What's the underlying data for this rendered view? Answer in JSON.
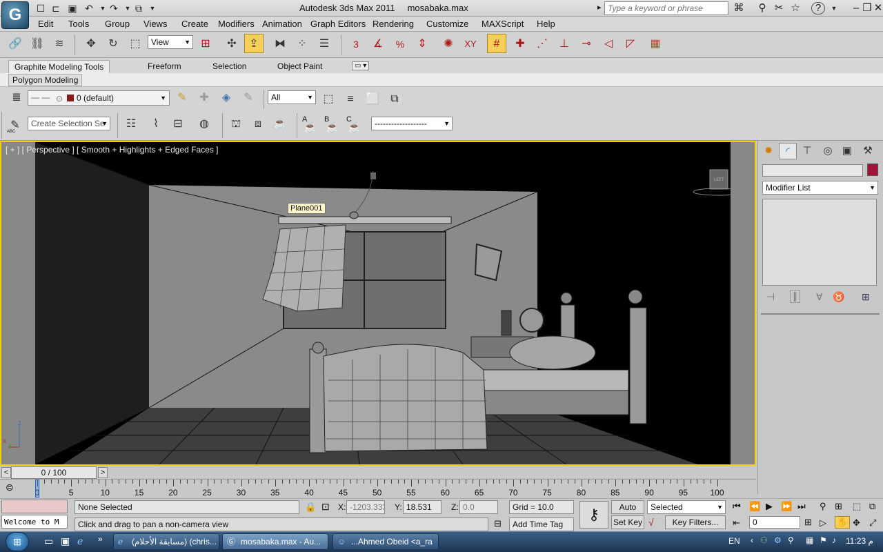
{
  "window": {
    "app_title": "Autodesk 3ds Max  2011",
    "file_name": "mosabaka.max",
    "search_placeholder": "Type a keyword or phrase",
    "help_label": "?"
  },
  "menu": [
    "Edit",
    "Tools",
    "Group",
    "Views",
    "Create",
    "Modifiers",
    "Animation",
    "Graph Editors",
    "Rendering",
    "Customize",
    "MAXScript",
    "Help"
  ],
  "main_toolbar": {
    "reference_coord": "View",
    "snap_3": "3",
    "percent_snap": "%",
    "xy_label": "XY"
  },
  "ribbon": {
    "tabs": [
      "Graphite Modeling Tools",
      "Freeform",
      "Selection",
      "Object Paint"
    ],
    "active_panel": "Polygon Modeling",
    "layer_name": "0 (default)",
    "filter_all": "All",
    "named_selection": "Create Selection Se",
    "dash_dropdown": "-------------------",
    "abc_label": "ABC",
    "a_label": "A",
    "b_label": "B",
    "c_label": "C"
  },
  "viewport": {
    "label": "[ + ] [ Perspective ] [ Smooth + Highlights + Edged Faces ]",
    "tooltip": "Plane001",
    "viewcube_label": "LEFT",
    "axis_z": "z",
    "axis_x": "x",
    "axis_y": "y"
  },
  "command_panel": {
    "object_name": "",
    "modifier_list": "Modifier List"
  },
  "timeline": {
    "slider": "0 / 100",
    "prev": "<",
    "next": ">",
    "ticks": [
      "0",
      "5",
      "10",
      "15",
      "20",
      "25",
      "30",
      "35",
      "40",
      "45",
      "50",
      "55",
      "60",
      "65",
      "70",
      "75",
      "80",
      "85",
      "90",
      "95",
      "100"
    ]
  },
  "status": {
    "listener": "Welcome to M",
    "selection": "None Selected",
    "prompt": "Click and drag to pan a non-camera view",
    "x_label": "X:",
    "x_value": "-1203.333",
    "y_label": "Y:",
    "y_value": "18.531",
    "z_label": "Z:",
    "z_value": "0.0",
    "grid": "Grid = 10.0",
    "add_time_tag": "Add Time Tag",
    "auto_key": "Auto Key",
    "set_key": "Set Key",
    "selected": "Selected",
    "key_filters": "Key Filters...",
    "frame": "0"
  },
  "taskbar": {
    "items": [
      "(مسابقة الأحلام) (chris...",
      "mosabaka.max - Au...",
      "...Ahmed Obeid <a_ra"
    ],
    "lang": "EN",
    "time": "11:23 م"
  },
  "colors": {
    "viewport_border": "#f5d000",
    "active_button": "#f6cf58",
    "layer_swatch": "#8b1a1a",
    "object_color": "#a0143c"
  }
}
